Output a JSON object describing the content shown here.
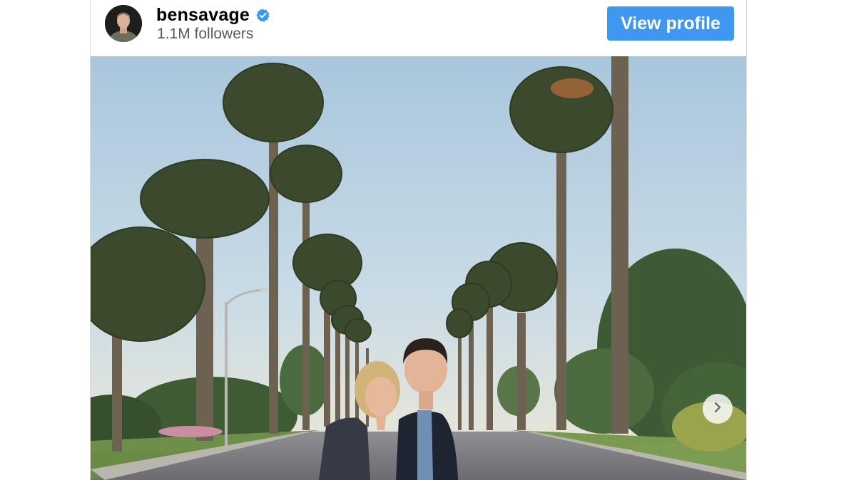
{
  "post_header": {
    "username": "bensavage",
    "verified": true,
    "followers": "1.1M followers",
    "view_profile_label": "View profile"
  },
  "colors": {
    "accent": "#3f97ef",
    "verified_badge": "#3897f0",
    "followers_text": "#5a5a5a"
  },
  "icons": {
    "verified": "verified-badge-icon",
    "next": "chevron-right-icon"
  }
}
